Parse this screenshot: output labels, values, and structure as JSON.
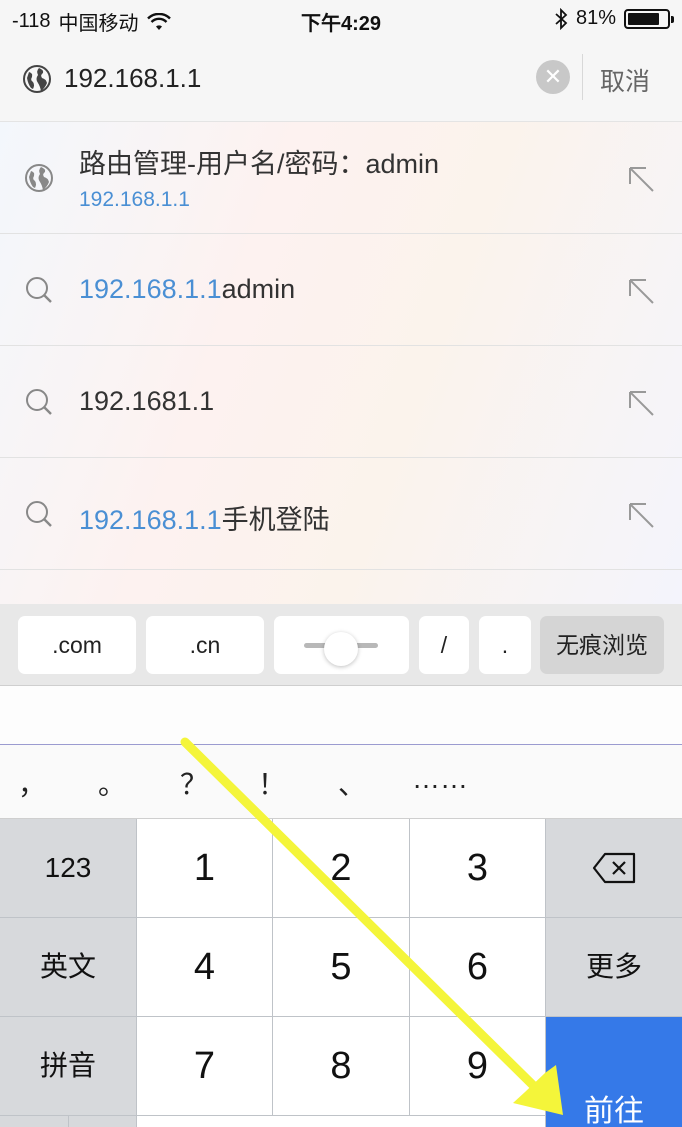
{
  "status_bar": {
    "signal": "-118",
    "carrier": "中国移动",
    "time": "下午4:29",
    "battery": "81%",
    "battery_level": 0.81
  },
  "address_bar": {
    "value": "192.168.1.1",
    "cancel_label": "取消"
  },
  "suggestions": [
    {
      "icon": "globe-icon",
      "title": "路由管理-用户名/密码：admin",
      "subtitle": "192.168.1.1"
    },
    {
      "icon": "search-icon",
      "highlight": "192.168.1.1",
      "rest": "admin"
    },
    {
      "icon": "search-icon",
      "highlight": "",
      "rest": "192.1681.1"
    },
    {
      "icon": "search-icon",
      "highlight": "192.168.1.1",
      "rest": "手机登陆"
    }
  ],
  "quickbar": {
    "keys": [
      ".com",
      ".cn",
      "/",
      "."
    ],
    "incognito_label": "无痕浏览"
  },
  "punctuation": [
    "，",
    "。",
    "？",
    "！",
    "、",
    "……"
  ],
  "keyboard": {
    "num_toggle": "123",
    "english": "英文",
    "pinyin": "拼音",
    "more": "更多",
    "go": "前往",
    "digits": [
      "1",
      "2",
      "3",
      "4",
      "5",
      "6",
      "7",
      "8",
      "9"
    ]
  },
  "colors": {
    "link_blue": "#4a8fd4",
    "go_button": "#3579e8",
    "annotation_arrow": "#f4f53a"
  }
}
